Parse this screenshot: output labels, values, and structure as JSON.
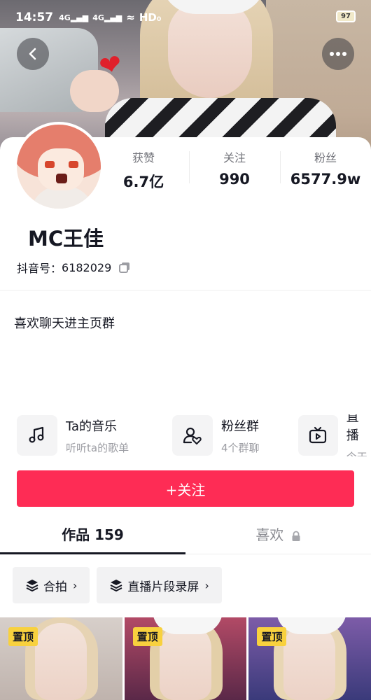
{
  "status_bar": {
    "time": "14:57",
    "signal1": "4G",
    "signal2": "4G",
    "hd": "HD₀",
    "battery": "97"
  },
  "header": {
    "back_icon": "chevron-left-icon",
    "more_icon": "more-dots-icon"
  },
  "profile": {
    "name": "MC王佳",
    "douyin_id_label": "抖音号：",
    "douyin_id": "6182029",
    "bio": "喜欢聊天进主页群",
    "stats": [
      {
        "label": "获赞",
        "value": "6.7亿"
      },
      {
        "label": "关注",
        "value": "990"
      },
      {
        "label": "粉丝",
        "value": "6577.9w"
      }
    ]
  },
  "features": [
    {
      "icon": "music-note-icon",
      "title": "Ta的音乐",
      "subtitle": "听听ta的歌单"
    },
    {
      "icon": "fan-group-icon",
      "title": "粉丝群",
      "subtitle": "4个群聊"
    },
    {
      "icon": "live-tv-icon",
      "title": "直播",
      "subtitle": "今天"
    }
  ],
  "follow_button": "+关注",
  "tabs": [
    {
      "label": "作品 159",
      "active": true
    },
    {
      "label": "喜欢",
      "active": false,
      "locked": true
    }
  ],
  "chips": [
    {
      "icon": "layers-icon",
      "label": "合拍"
    },
    {
      "icon": "layers-icon",
      "label": "直播片段录屏"
    }
  ],
  "videos": [
    {
      "badge": "置顶"
    },
    {
      "badge": "置顶"
    },
    {
      "badge": "置顶"
    }
  ],
  "colors": {
    "accent": "#fe2c55",
    "pin_badge": "#f8d13e",
    "text_primary": "#161823",
    "text_secondary": "#73747b"
  }
}
